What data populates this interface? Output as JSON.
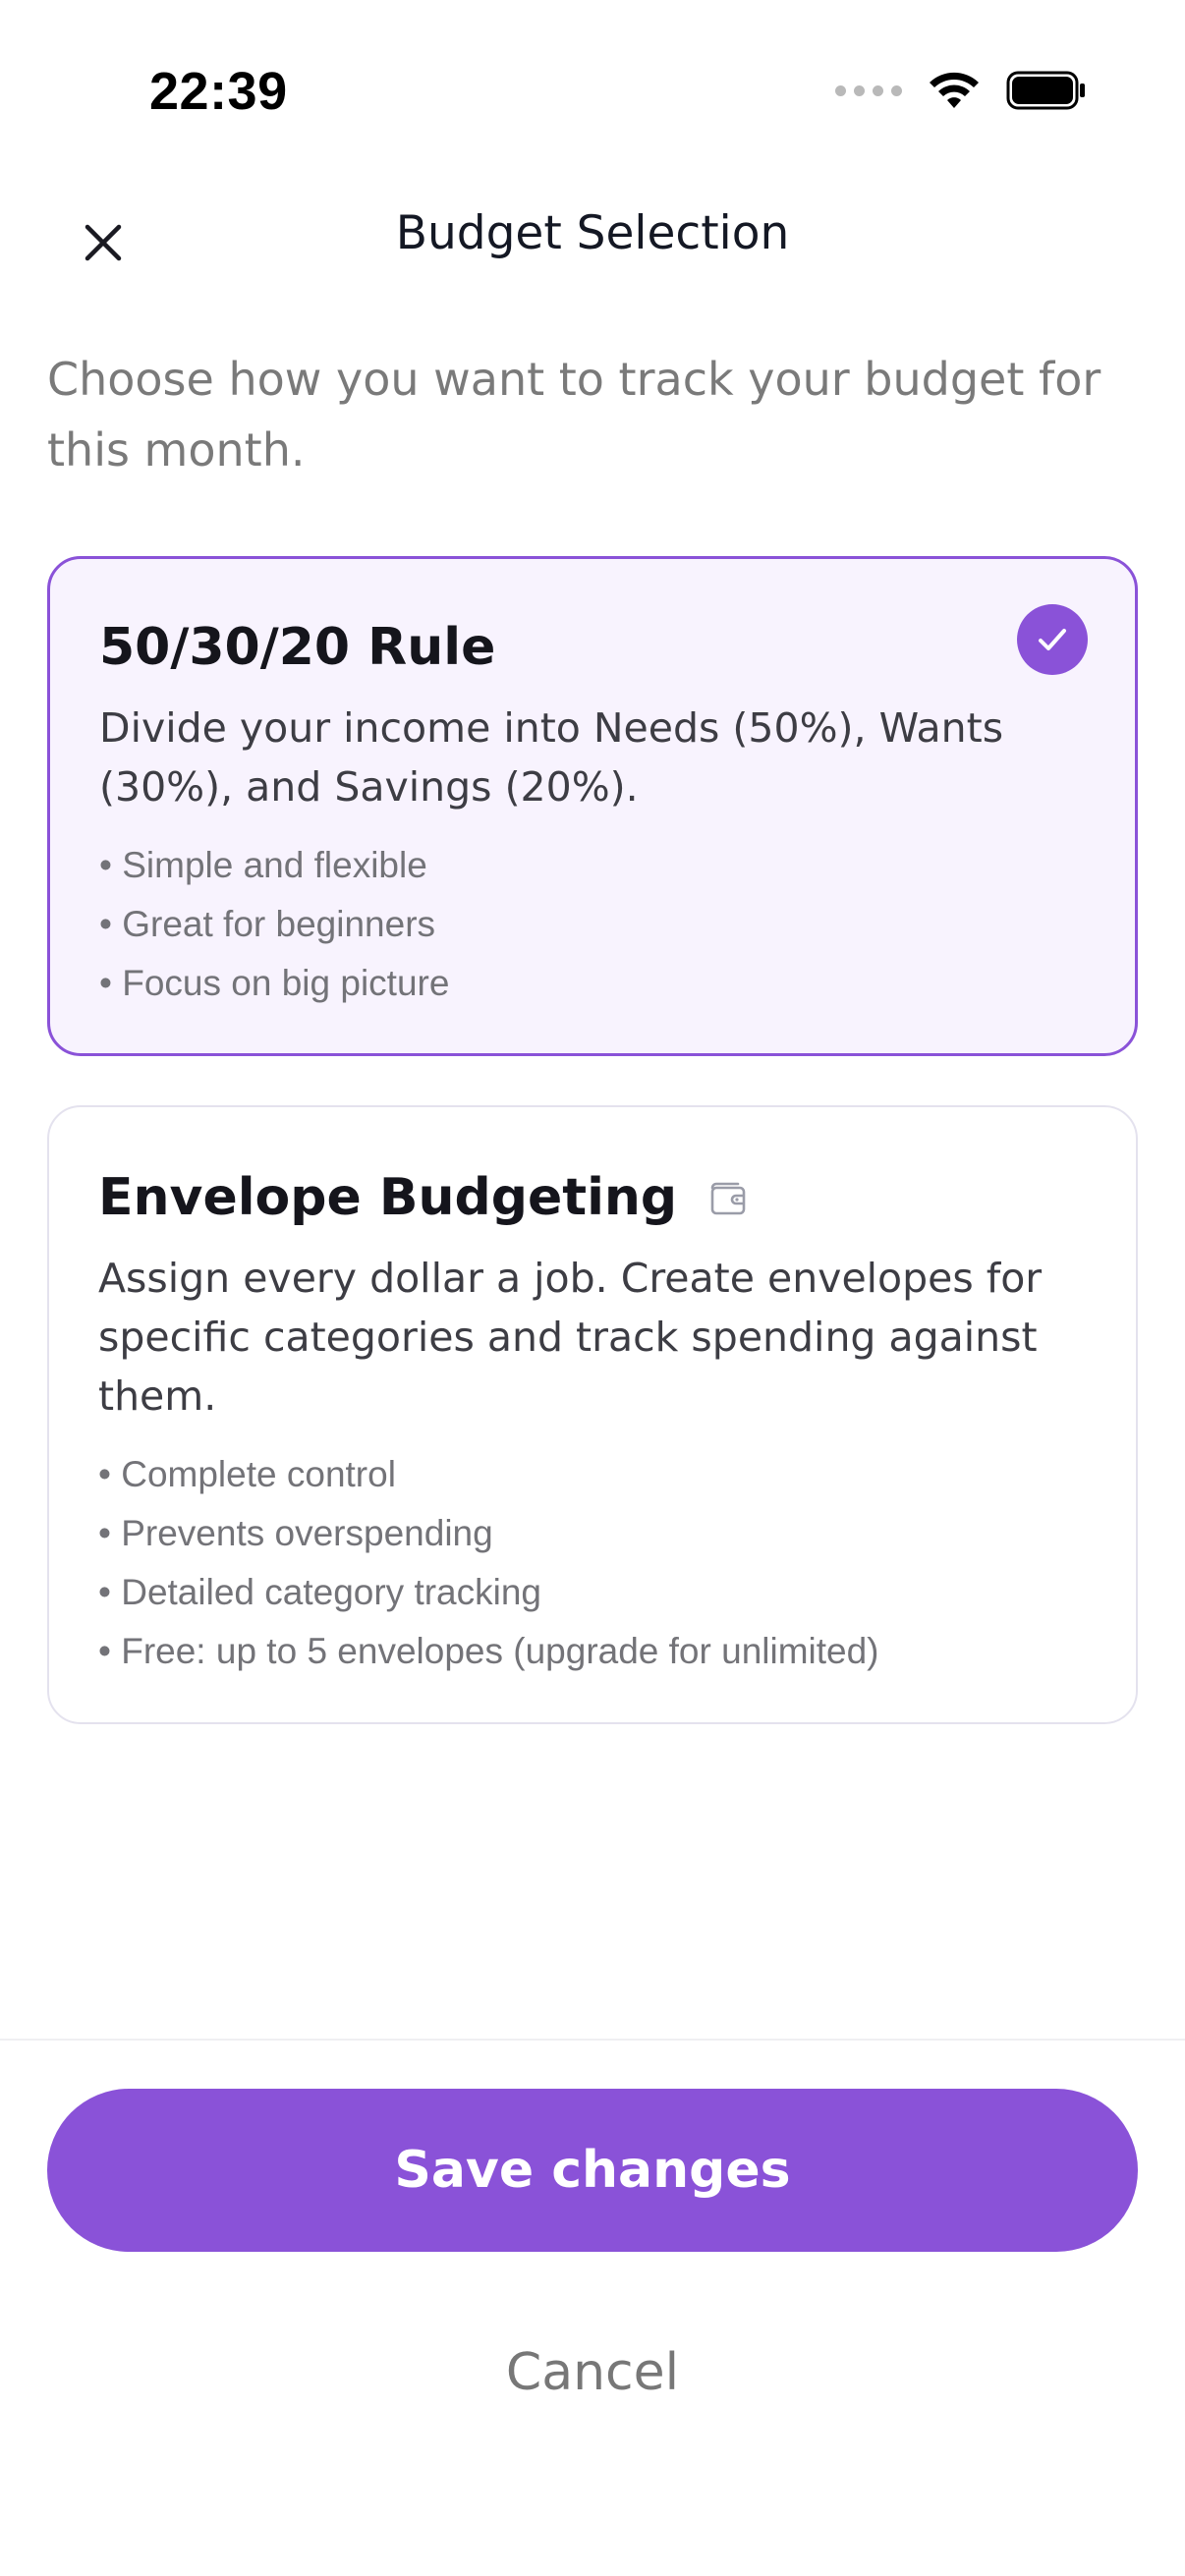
{
  "status_bar": {
    "time": "22:39"
  },
  "header": {
    "title": "Budget Selection",
    "close_icon": "close-icon"
  },
  "intro": "Choose how you want to track your budget for this month.",
  "options": [
    {
      "title": "50/30/20 Rule",
      "selected": true,
      "description": "Divide your income into Needs (50%), Wants (30%), and Savings (20%).",
      "bullets": [
        "• Simple and flexible",
        "• Great for beginners",
        "• Focus on big picture"
      ]
    },
    {
      "title": "Envelope Budgeting",
      "selected": false,
      "icon": "wallet-icon",
      "description": "Assign every dollar a job. Create envelopes for specific categories and track spending against them.",
      "bullets": [
        "• Complete control",
        "• Prevents overspending",
        "• Detailed category tracking",
        "• Free: up to 5 envelopes (upgrade for unlimited)"
      ]
    }
  ],
  "actions": {
    "save_label": "Save changes",
    "cancel_label": "Cancel"
  },
  "colors": {
    "accent": "#8a52d8",
    "selected_bg": "#f8f3fe"
  }
}
